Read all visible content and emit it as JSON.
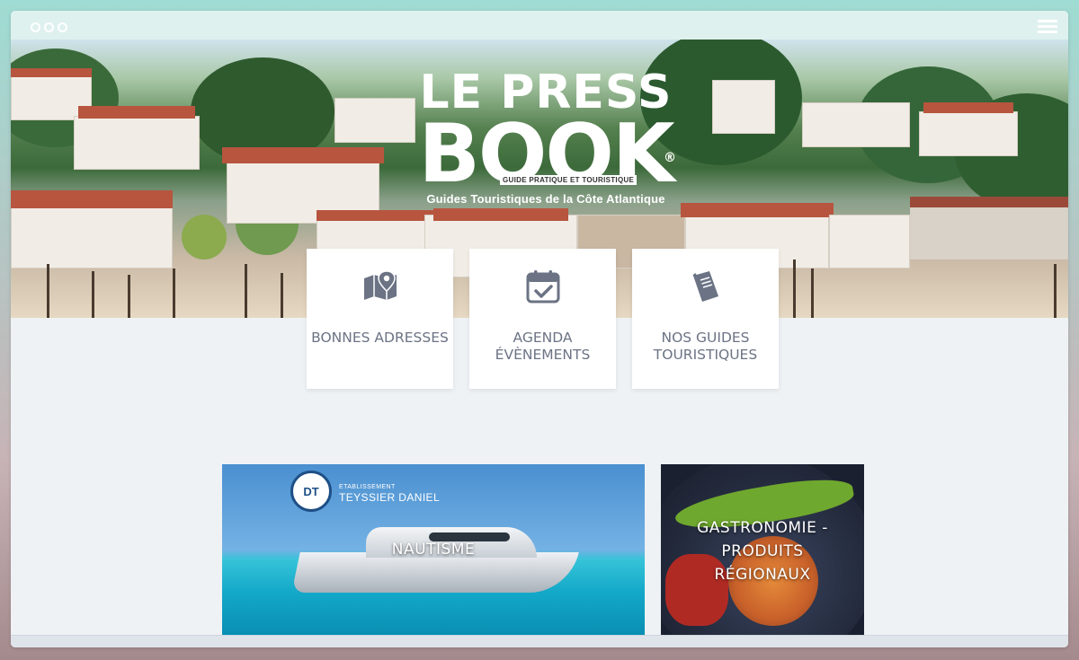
{
  "window": {
    "title_dots": [
      "dot-1",
      "dot-2",
      "dot-3"
    ],
    "menu_icon": "hamburger-menu-icon"
  },
  "hero": {
    "logo_line1": "LE PRESS",
    "logo_line2": "BOOK",
    "logo_registered": "®",
    "logo_tag": "GUIDE PRATIQUE ET TOURISTIQUE",
    "logo_subtitle": "Guides Touristiques de la Côte Atlantique"
  },
  "cards": [
    {
      "label": "BONNES ADRESSES",
      "icon": "map-pin-icon"
    },
    {
      "label": "AGENDA ÉVÈNEMENTS",
      "icon": "calendar-check-icon"
    },
    {
      "label": "NOS GUIDES TOURISTIQUES",
      "icon": "book-icon"
    }
  ],
  "tiles": [
    {
      "label": "NAUTISME",
      "establishment_prefix": "ETABLISSEMENT",
      "establishment_name": "TEYSSIER DANIEL",
      "badge_text": "DT"
    },
    {
      "label": "GASTRONOMIE - PRODUITS RÉGIONAUX"
    }
  ],
  "colors": {
    "accent_teal": "#9fdcd3",
    "card_text": "#6b7384",
    "icon": "#6b7384",
    "roof": "#b8553f"
  }
}
